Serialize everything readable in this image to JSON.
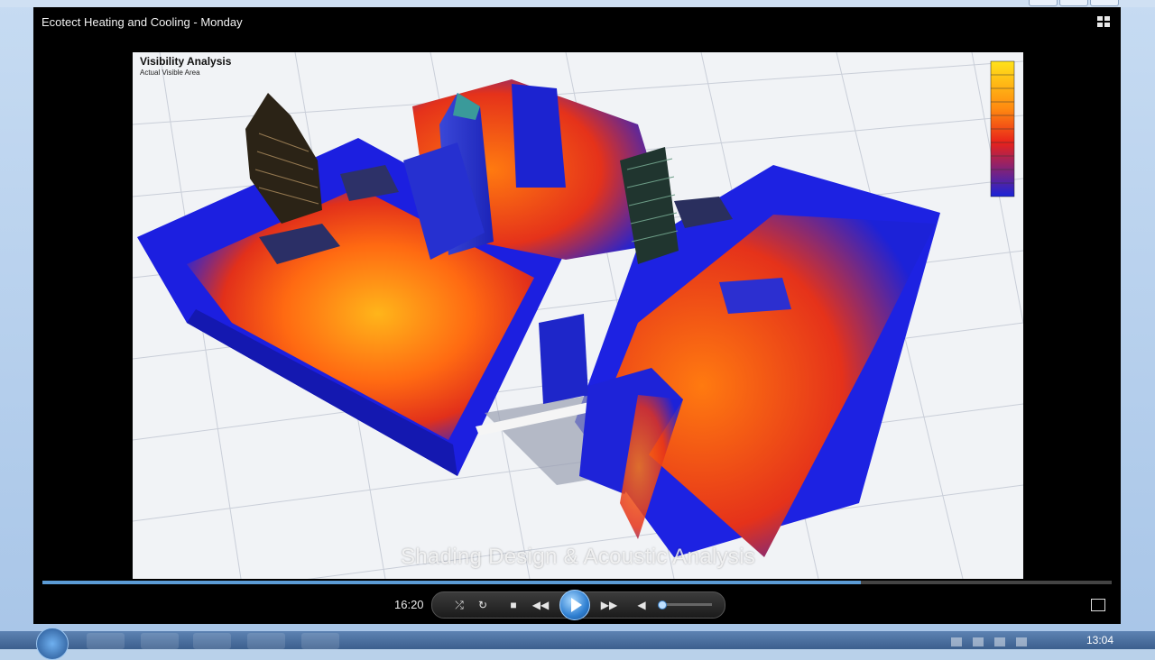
{
  "window": {
    "title": "Ecotect Heating and  Cooling - Monday"
  },
  "video": {
    "vis_title": "Visibility Analysis",
    "vis_subtitle": "Actual Visible Area",
    "subtitle_text": "Shading Design & Acoustic Analysis"
  },
  "player": {
    "elapsed_time": "16:20",
    "progress": 0.765,
    "volume": 0.0
  },
  "icons": {
    "layout": "layout-switch-icon",
    "shuffle": "shuffle-icon",
    "repeat": "repeat-icon",
    "stop": "stop-icon",
    "previous": "previous-icon",
    "play": "play-icon",
    "next": "next-icon",
    "volume": "volume-icon",
    "fullscreen": "fullscreen-icon"
  },
  "taskbar": {
    "clock": "13:04"
  },
  "colors": {
    "accent": "#5b9bd5",
    "heat_blue": "#1a23d8",
    "heat_orange": "#ff7a10",
    "heat_red": "#e2261a",
    "heat_yellow": "#ffd21a"
  }
}
